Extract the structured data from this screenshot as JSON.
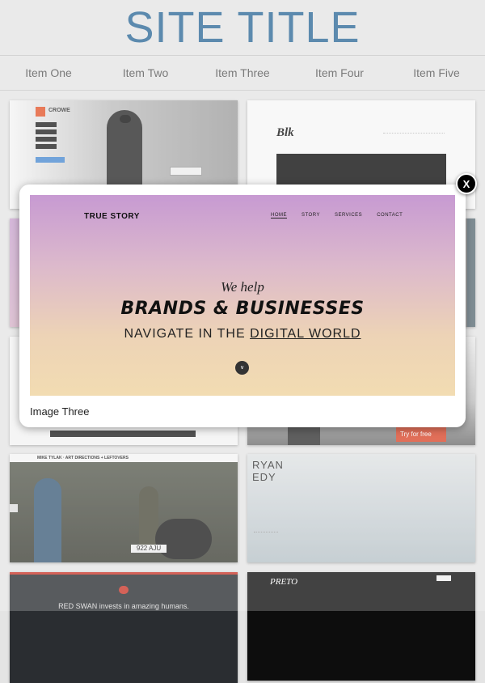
{
  "site_title": "SITE TITLE",
  "nav": [
    "Item One",
    "Item Two",
    "Item Three",
    "Item Four",
    "Item Five"
  ],
  "thumbs": {
    "crowe": {
      "brand": "CROWE"
    },
    "blk": {
      "brand": "Blk"
    },
    "try_free": "Try for free",
    "tylak": {
      "header": "MIKE TYLAK · ART DIRECTIONS + LEFTOVERS",
      "plate": "922 AJU"
    },
    "ryan": {
      "name_line1": "RYAN",
      "name_line2": "EDY"
    },
    "redswan": {
      "text": "RED SWAN invests in amazing humans."
    },
    "preto": {
      "brand": "PRETO"
    }
  },
  "lightbox": {
    "logo": "TRUE STORY",
    "nav": [
      "HOME",
      "STORY",
      "SERVICES",
      "CONTACT"
    ],
    "line1": "We help",
    "line2": "BRANDS & BUSINESSES",
    "line3_prefix": "NAVIGATE IN THE ",
    "line3_link": "DIGITAL WORLD",
    "down_icon": "chevron-down-icon",
    "caption": "Image Three",
    "close_label": "X"
  }
}
